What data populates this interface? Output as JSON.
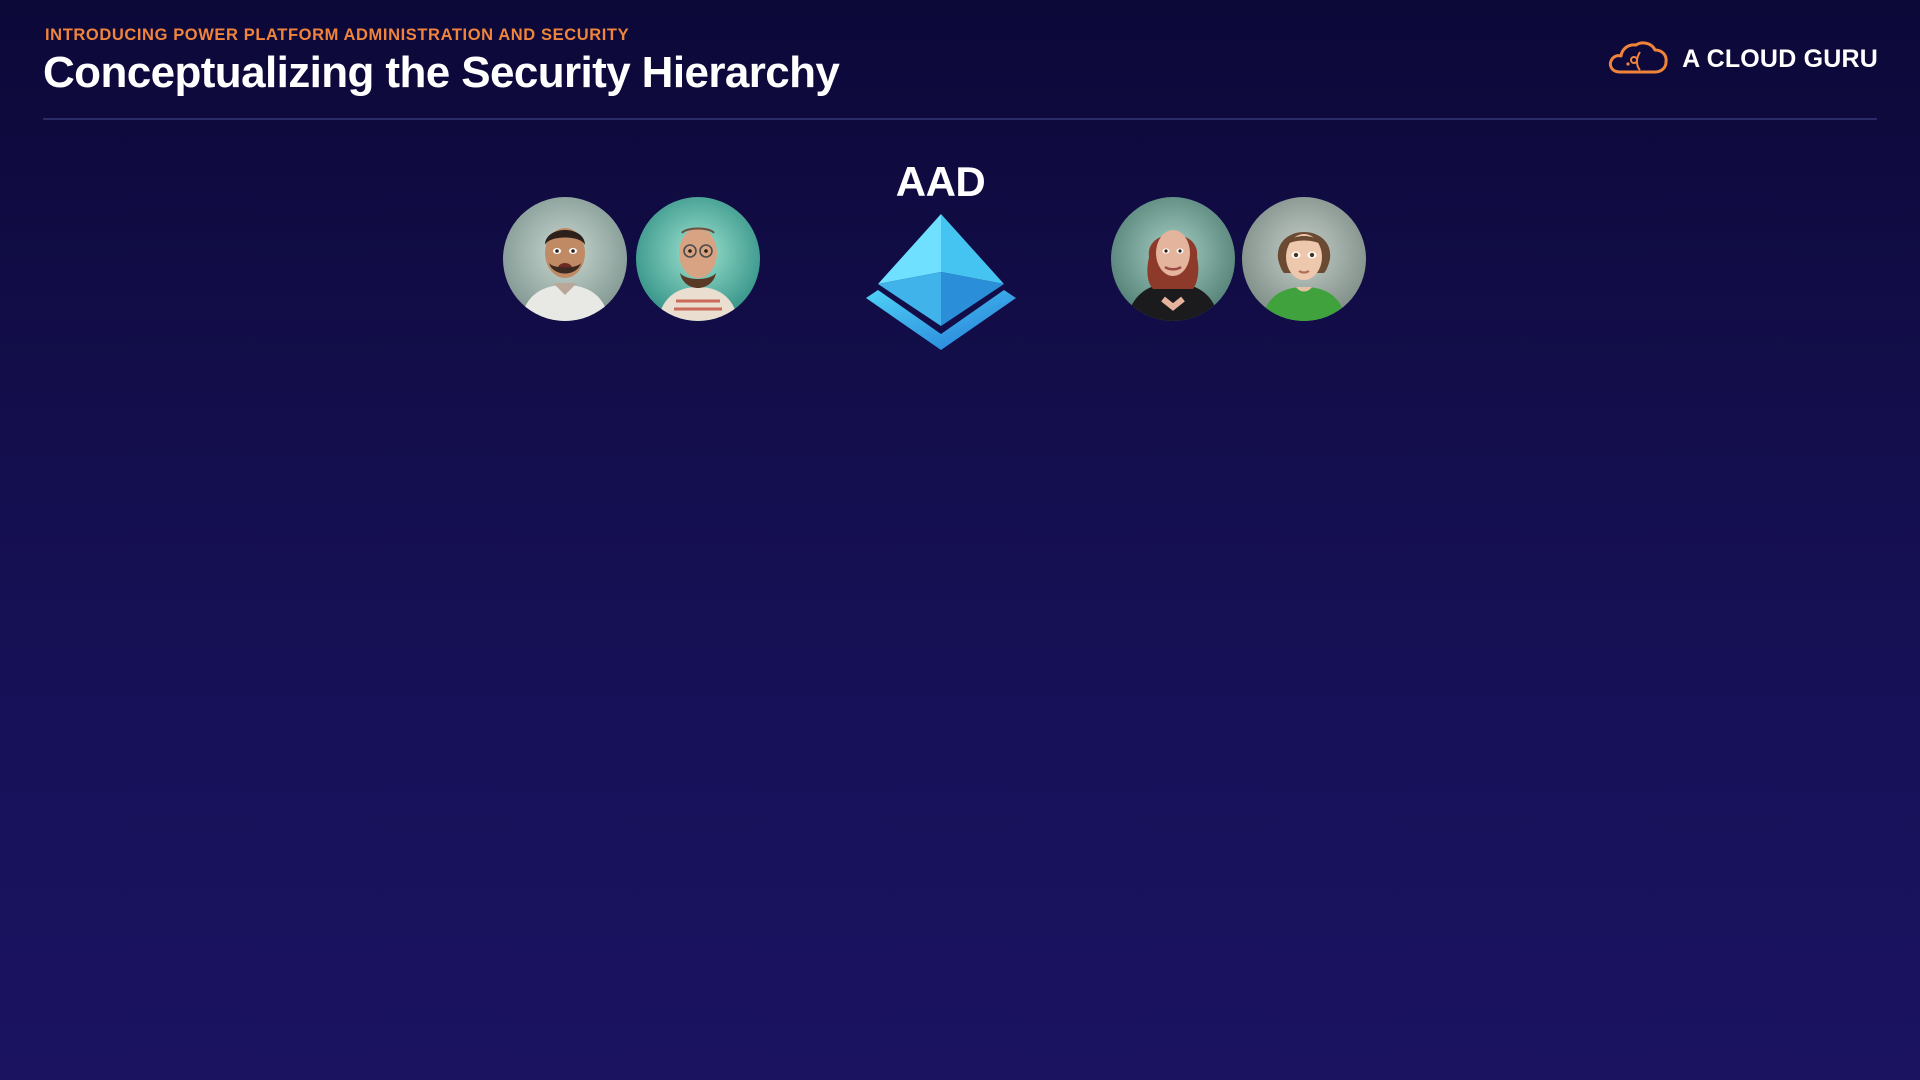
{
  "header": {
    "kicker": "INTRODUCING POWER PLATFORM ADMINISTRATION AND SECURITY",
    "title": "Conceptualizing the Security Hierarchy"
  },
  "brand": {
    "name": "A CLOUD GURU",
    "logo_icon": "cloud-logo-icon"
  },
  "diagram": {
    "center_label": "AAD",
    "center_icon": "azure-active-directory-icon",
    "left_users": [
      {
        "name": "user-avatar-1",
        "description_icon": "person-photo-icon"
      },
      {
        "name": "user-avatar-2",
        "description_icon": "person-photo-icon"
      }
    ],
    "right_users": [
      {
        "name": "user-avatar-3",
        "description_icon": "person-photo-icon"
      },
      {
        "name": "user-avatar-4",
        "description_icon": "person-photo-icon"
      }
    ]
  },
  "colors": {
    "background_top": "#0c0838",
    "background_bottom": "#1b1360",
    "kicker": "#f0843a",
    "title": "#ffffff",
    "aad_light": "#5ad6f5",
    "aad_dark": "#2a8ed8"
  }
}
